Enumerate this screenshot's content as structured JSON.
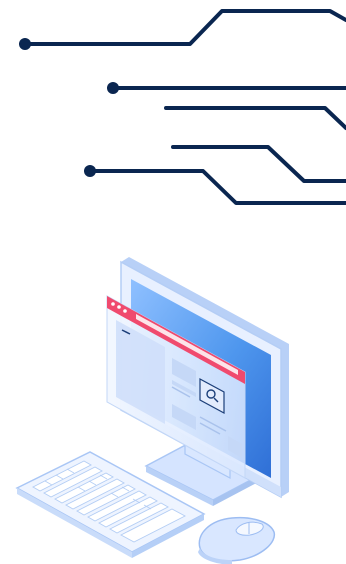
{
  "illustration": {
    "circuit_icon": "circuit-lines-icon",
    "computer_icon": "desktop-computer-icon",
    "keyboard_icon": "keyboard-icon",
    "mouse_icon": "mouse-icon",
    "search_icon": "magnifier-icon"
  },
  "colors": {
    "circuit": "#0a2650",
    "browser_bar": "#f04a6e",
    "screen_blue": "#3f8ee8",
    "device_light": "#e7efff",
    "device_mid": "#c9dcfa",
    "device_stroke": "#9dbdf2"
  }
}
